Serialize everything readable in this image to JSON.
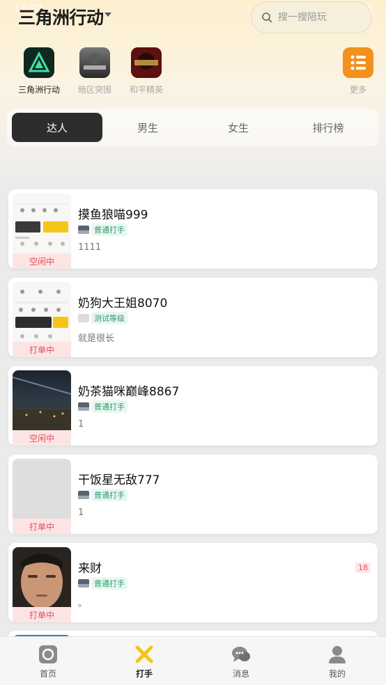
{
  "status_bar": {
    "time": "13:20"
  },
  "header": {
    "title": "三角洲行动",
    "search_placeholder": "搜一搜陪玩"
  },
  "games": [
    {
      "label": "三角洲行动",
      "icon": "delta-force-icon",
      "active": true
    },
    {
      "label": "暗区突围",
      "icon": "arena-breakout-icon",
      "active": false
    },
    {
      "label": "和平精英",
      "icon": "peace-elite-icon",
      "active": false
    },
    {
      "label": "更多",
      "icon": "more-list-icon",
      "active": false
    }
  ],
  "segments": [
    {
      "label": "达人",
      "active": true
    },
    {
      "label": "男生",
      "active": false
    },
    {
      "label": "女生",
      "active": false
    },
    {
      "label": "排行榜",
      "active": false
    }
  ],
  "cards": [
    {
      "name": "摸鱼狼喵999",
      "level": "普通打手",
      "desc": "1111",
      "status": "空闲中",
      "age": ""
    },
    {
      "name": "奶狗大王姐8070",
      "level": "测试等级",
      "desc": "就是很长",
      "status": "打单中",
      "age": ""
    },
    {
      "name": "奶茶猫咪巅峰8867",
      "level": "普通打手",
      "desc": "1",
      "status": "空闲中",
      "age": ""
    },
    {
      "name": "干饭星无敌777",
      "level": "普通打手",
      "desc": "1",
      "status": "打单中",
      "age": ""
    },
    {
      "name": "来财",
      "level": "普通打手",
      "desc": "。",
      "status": "打单中",
      "age": "18"
    }
  ],
  "tabbar": [
    {
      "label": "首页",
      "icon": "home-icon",
      "active": false
    },
    {
      "label": "打手",
      "icon": "player-icon",
      "active": true
    },
    {
      "label": "消息",
      "icon": "message-icon",
      "active": false
    },
    {
      "label": "我的",
      "icon": "profile-icon",
      "active": false
    }
  ],
  "colors": {
    "accent_yellow": "#f5c518",
    "status_red": "#e0505a",
    "level_green": "#2e9a70",
    "segment_active": "#2d2d2d"
  }
}
